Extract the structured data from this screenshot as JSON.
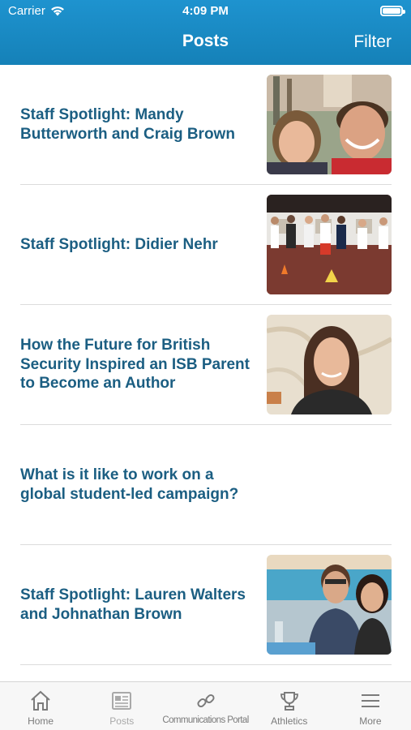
{
  "status_bar": {
    "carrier": "Carrier",
    "time": "4:09 PM"
  },
  "nav": {
    "title": "Posts",
    "filter_label": "Filter"
  },
  "posts": [
    {
      "title": "Staff Spotlight: Mandy Butterworth and Craig Brown",
      "has_image": true
    },
    {
      "title": "Staff Spotlight: Didier Nehr",
      "has_image": true
    },
    {
      "title": "How the Future for British Security Inspired an ISB Parent to Become an Author",
      "has_image": true
    },
    {
      "title": "What is it like to work on a global student-led campaign?",
      "has_image": false
    },
    {
      "title": "Staff Spotlight: Lauren Walters and Johnathan Brown",
      "has_image": true
    }
  ],
  "tabs": [
    {
      "label": "Home",
      "icon": "home-icon"
    },
    {
      "label": "Posts",
      "icon": "newspaper-icon",
      "active": true
    },
    {
      "label": "Communications Portal",
      "icon": "link-icon"
    },
    {
      "label": "Athletics",
      "icon": "trophy-icon"
    },
    {
      "label": "More",
      "icon": "menu-icon"
    }
  ],
  "colors": {
    "header": "#1a8bc4",
    "title_text": "#1b5e82",
    "tab_inactive": "#7b7b7b"
  }
}
